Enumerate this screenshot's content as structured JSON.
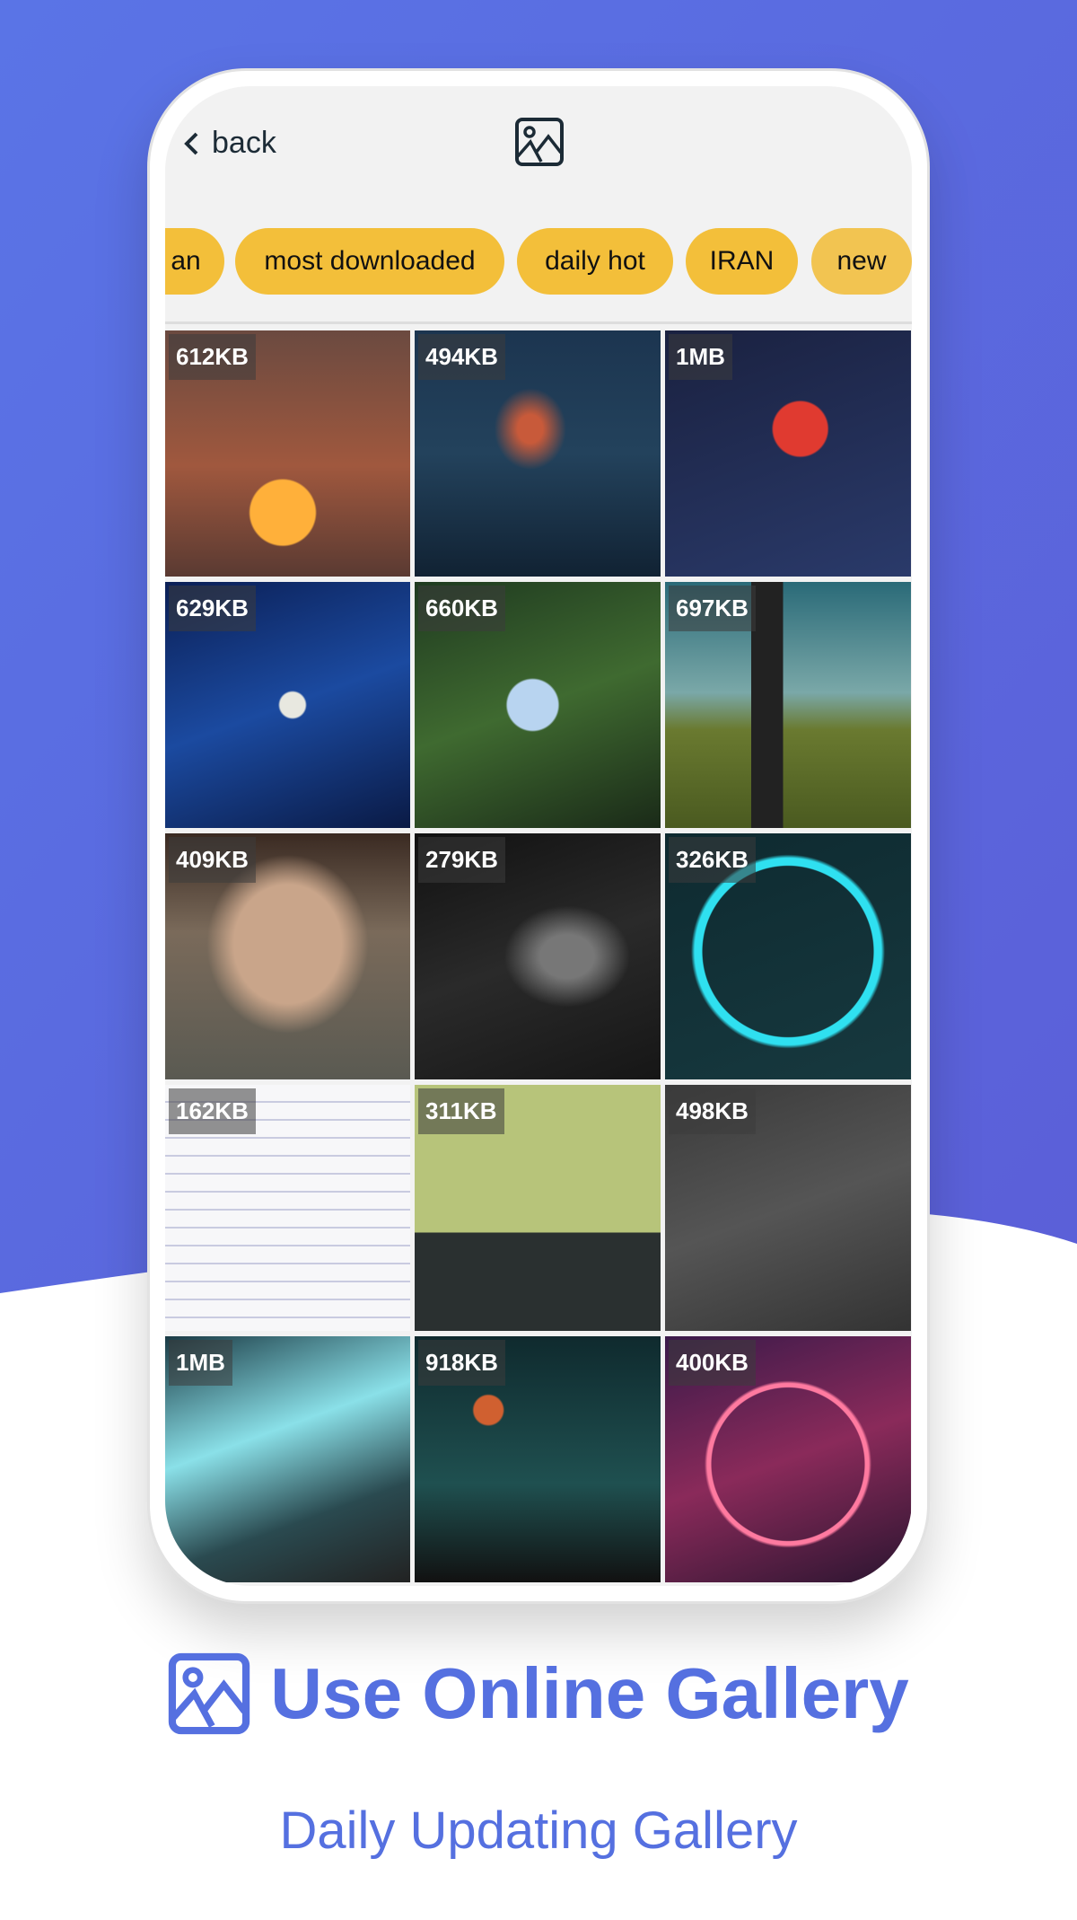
{
  "header": {
    "back_label": "back",
    "icon": "image-icon"
  },
  "chips": [
    {
      "label": "an"
    },
    {
      "label": "most downloaded"
    },
    {
      "label": "daily hot"
    },
    {
      "label": "IRAN"
    },
    {
      "label": "new"
    }
  ],
  "gallery": [
    {
      "size": "612KB",
      "bg": "linear-gradient(180deg,#6b4a40,#a0583e 55%,#5a3a32)",
      "accent": "radial-gradient(circle at 48% 74%,#ffb03a 0 36px,transparent 38px)"
    },
    {
      "size": "494KB",
      "bg": "linear-gradient(180deg,#1c3550,#23425c 50%,#112233)",
      "accent": "radial-gradient(ellipse at 47% 40%,#c85a3a 0 14px,transparent 40px)"
    },
    {
      "size": "1MB",
      "bg": "linear-gradient(160deg,#1a2140,#2a3a6a)",
      "accent": "radial-gradient(circle at 55% 40%,#e03a30 0 30px,transparent 32px)"
    },
    {
      "size": "629KB",
      "bg": "linear-gradient(160deg,#0b1f55,#1b4aa0 50%,#0a1a45)",
      "accent": "radial-gradient(circle at 52% 50%,#e8e8e0 0 14px,transparent 16px)"
    },
    {
      "size": "660KB",
      "bg": "linear-gradient(160deg,#1f3a20,#3f6a30 50%,#1a2a18)",
      "accent": "radial-gradient(circle at 48% 50%,#b8d4f0 0 28px,transparent 30px)"
    },
    {
      "size": "697KB",
      "bg": "linear-gradient(180deg,#2a6a78,#7aa8a8 45%,#6a7a30 60%,#4a5a20)",
      "accent": "linear-gradient(90deg,transparent 35%,#222 35% 48%,transparent 48%)"
    },
    {
      "size": "409KB",
      "bg": "linear-gradient(180deg,#3a2a22,#7a6a5a 40%,#5a5a52)",
      "accent": "radial-gradient(ellipse at 50% 45%,#c9a58a 0 60px,transparent 90px)"
    },
    {
      "size": "279KB",
      "bg": "linear-gradient(160deg,#111,#2a2a2a 50%,#161616)",
      "accent": "radial-gradient(ellipse at 62% 50%,#777 0 30px,transparent 70px)"
    },
    {
      "size": "326KB",
      "bg": "linear-gradient(160deg,#0e2a30,#17393f)",
      "accent": "radial-gradient(circle at 50% 48%,transparent 0 95px,#2fe0f0 96px 104px,transparent 108px)"
    },
    {
      "size": "162KB",
      "bg": "repeating-linear-gradient(180deg,#f7f7f9 0 18px,#c9cbe0 18px 20px)",
      "accent": "none"
    },
    {
      "size": "311KB",
      "bg": "linear-gradient(180deg,#b7c47a 0 60%,#2a3030 60%)",
      "accent": "none"
    },
    {
      "size": "498KB",
      "bg": "linear-gradient(160deg,#3a3a3a,#555 50%,#333)",
      "accent": "none"
    },
    {
      "size": "1MB",
      "bg": "linear-gradient(160deg,#1a3a44,#8ae0e8 40%,#2a4a50 70%,#222)",
      "accent": "none"
    },
    {
      "size": "918KB",
      "bg": "linear-gradient(180deg,#0f2a2e,#1f5050 60%,#111)",
      "accent": "radial-gradient(circle at 30% 30%,#d06030 0 16px,transparent 18px)"
    },
    {
      "size": "400KB",
      "bg": "linear-gradient(160deg,#3a1a4a,#8a2a5a 50%,#2a1530)",
      "accent": "radial-gradient(circle at 50% 52%,transparent 0 85px,#ff7aa0 86px 90px,transparent 93px)"
    }
  ],
  "footer": {
    "title": "Use Online Gallery",
    "subtitle": "Daily Updating Gallery",
    "icon": "image-icon"
  },
  "colors": {
    "accent": "#5570e0",
    "background_top": "#5b6ee0",
    "chip": "#f3bf3a"
  }
}
